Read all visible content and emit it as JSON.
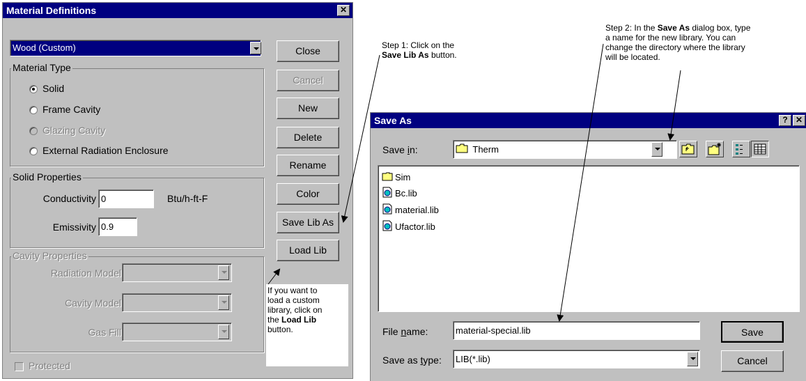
{
  "material_dialog": {
    "title": "Material Definitions",
    "close_icon": "close-icon",
    "material_select_value": "Wood (Custom)",
    "material_type": {
      "label": "Material Type",
      "options": [
        "Solid",
        "Frame Cavity",
        "Glazing Cavity",
        "External Radiation Enclosure"
      ],
      "selected": "Solid",
      "disabled": [
        "Glazing Cavity"
      ]
    },
    "solid_properties": {
      "label": "Solid Properties",
      "conductivity_label": "Conductivity",
      "conductivity_value": "0",
      "conductivity_unit": "Btu/h-ft-F",
      "emissivity_label": "Emissivity",
      "emissivity_value": "0.9"
    },
    "cavity_properties": {
      "label": "Cavity Properties",
      "radiation_model_label": "Radiation Model",
      "cavity_model_label": "Cavity Model",
      "gas_fill_label": "Gas Fill"
    },
    "protected_label": "Protected",
    "buttons": {
      "close": "Close",
      "cancel": "Cancel",
      "new": "New",
      "delete": "Delete",
      "rename": "Rename",
      "color": "Color",
      "save_lib_as": "Save Lib As",
      "load_lib": "Load Lib"
    }
  },
  "annotations": {
    "step1_line1": "Step 1: Click on the",
    "step1_bold": "Save Lib As",
    "step1_tail": "button.",
    "step2_pre": "Step 2: In the",
    "step2_bold": "Save As",
    "step2_line1_tail": "dialog box, type",
    "step2_line2": "a  name for the new library. You can",
    "step2_line3": "change the directory where the library",
    "step2_line4": "will be located.",
    "load_line1": "If you want to",
    "load_line2": "load a custom",
    "load_line3": "library, click on",
    "load_pre": "the",
    "load_bold": "Load Lib",
    "load_tail": "button."
  },
  "save_as_dialog": {
    "title": "Save As",
    "help_icon": "help-icon",
    "close_icon": "close-icon",
    "save_in_label": "Save in:",
    "save_in_value": "Therm",
    "files": [
      {
        "name": "Sim",
        "icon": "folder-icon"
      },
      {
        "name": "Bc.lib",
        "icon": "file-icon"
      },
      {
        "name": "material.lib",
        "icon": "file-icon"
      },
      {
        "name": "Ufactor.lib",
        "icon": "file-icon"
      }
    ],
    "file_name_label": "File name:",
    "file_name_value": "material-special.lib",
    "save_as_type_label": "Save as type:",
    "save_as_type_value": "LIB(*.lib)",
    "save_button": "Save",
    "cancel_button": "Cancel"
  },
  "colors": {
    "title_bar": "#000080",
    "dialog_face": "#c0c0c0",
    "selection": "#000080"
  }
}
